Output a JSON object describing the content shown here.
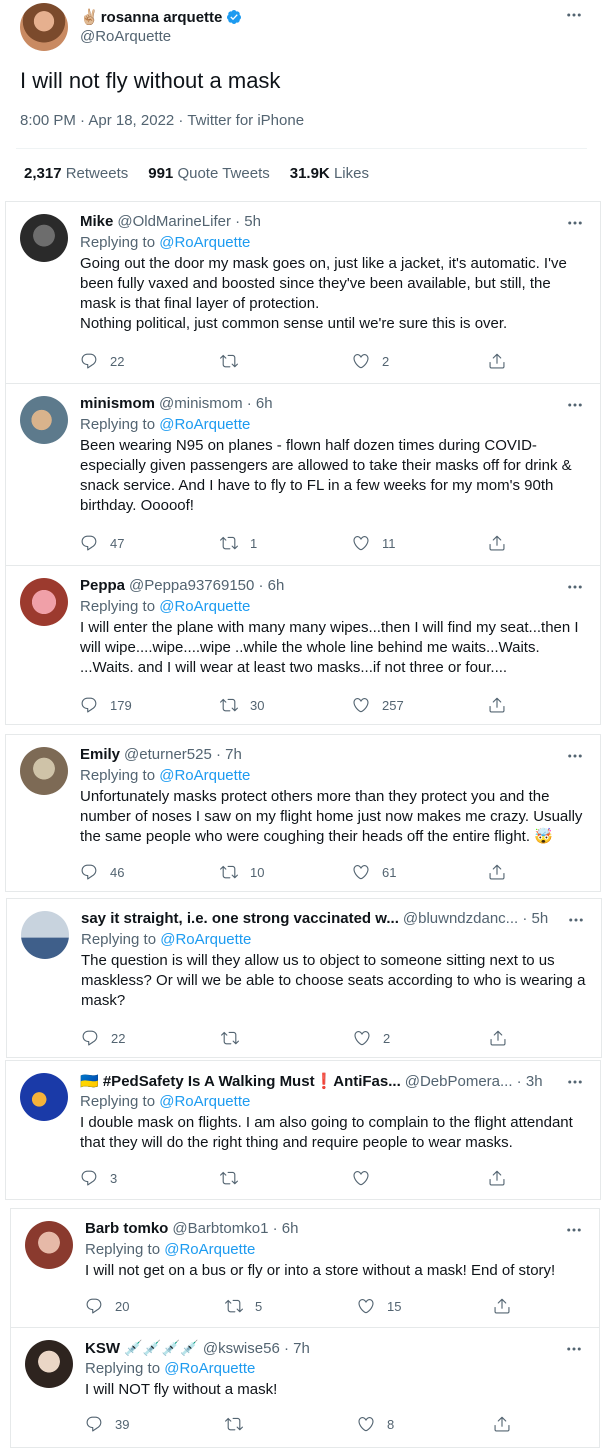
{
  "main_tweet": {
    "name_emoji": "✌🏼",
    "name": "rosanna arquette",
    "handle": "@RoArquette",
    "text": "I will not fly without a mask",
    "timestamp": "8:00 PM · Apr 18, 2022 · Twitter for iPhone",
    "stats": {
      "retweets_count": "2,317",
      "retweets_label": "Retweets",
      "quotes_count": "991",
      "quotes_label": "Quote Tweets",
      "likes_count": "31.9K",
      "likes_label": "Likes"
    }
  },
  "replying_to_prefix": "Replying to",
  "replies": [
    {
      "name": "Mike",
      "handle_time": "@OldMarineLifer · 5h",
      "replying_to": "@RoArquette",
      "body": [
        "Going out the door my mask goes on, just like a jacket, it's automatic. I've been fully vaxed and boosted since they've been available, but still, the mask is that final layer of protection.",
        "Nothing political, just common sense until we're sure this is over."
      ],
      "replies": "22",
      "retweets": "",
      "likes": "2"
    },
    {
      "name": "minismom",
      "handle_time": "@minismom · 6h",
      "replying_to": "@RoArquette",
      "body": [
        "Been wearing N95 on planes  - flown half dozen times during COVID- especially given passengers are allowed to take their masks off for drink & snack service.  And I have to fly to FL in a few weeks for my mom's 90th birthday.  Ooooof!"
      ],
      "replies": "47",
      "retweets": "1",
      "likes": "11"
    },
    {
      "name": "Peppa",
      "handle_time": "@Peppa93769150 · 6h",
      "replying_to": "@RoArquette",
      "body": [
        "I will enter the plane with many many wipes...then I will find my seat...then I will wipe....wipe....wipe ..while the whole line behind me waits...Waits. ...Waits.  and I will wear at least two masks...if not three or four...."
      ],
      "replies": "179",
      "retweets": "30",
      "likes": "257"
    },
    {
      "name": "Emily",
      "handle_time": "@eturner525 · 7h",
      "replying_to": "@RoArquette",
      "body": [
        "Unfortunately masks protect others more than they protect you and the number of noses I saw on my flight home just now makes me crazy. Usually the same people who were coughing their heads off the entire flight. 🤯"
      ],
      "replies": "46",
      "retweets": "10",
      "likes": "61"
    },
    {
      "name": "say it straight, i.e. one strong vaccinated w...",
      "handle_time": "@bluwndzdanc... · 5h",
      "replying_to": "@RoArquette",
      "body": [
        "The question is will they allow us to object to someone sitting next to us maskless? Or will we be able to choose seats according to who is wearing a mask?"
      ],
      "replies": "22",
      "retweets": "",
      "likes": "2"
    },
    {
      "name": "🇺🇦 #PedSafety Is A Walking Must❗AntiFas...",
      "handle_time": "@DebPomera... · 3h",
      "replying_to": "@RoArquette",
      "body": [
        "I double mask on flights. I am also going to complain to the flight attendant that they will do the right thing and require people to wear masks."
      ],
      "replies": "3",
      "retweets": "",
      "likes": ""
    },
    {
      "name": "Barb tomko",
      "handle_time": "@Barbtomko1 · 6h",
      "replying_to": "@RoArquette",
      "body": [
        "I will not get on a bus or fly or into a store without a mask! End of story!"
      ],
      "replies": "20",
      "retweets": "5",
      "likes": "15"
    },
    {
      "name": "KSW 💉💉💉💉",
      "handle_time": "@kswise56 · 7h",
      "replying_to": "@RoArquette",
      "body": [
        "I will NOT fly without a mask!"
      ],
      "replies": "39",
      "retweets": "",
      "likes": "8"
    }
  ],
  "colors": {
    "text": "#0f1419",
    "secondary": "#536471",
    "link": "#1d9bf0",
    "verified": "#1d9bf0",
    "divider": "#eff3f4"
  },
  "icons": [
    "verified-badge-icon",
    "more-icon",
    "reply-icon",
    "retweet-icon",
    "like-icon",
    "share-icon"
  ]
}
